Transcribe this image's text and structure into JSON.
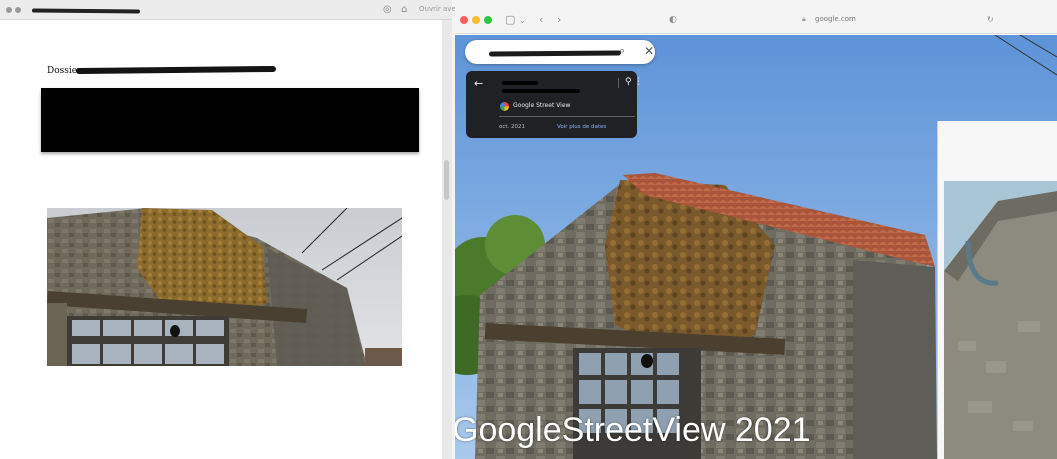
{
  "left_window": {
    "url_fragment": "Ouvrir avec",
    "dossier_label": "Dossier"
  },
  "browser": {
    "url": "google.com",
    "traffic_lights": {
      "close": "#fe5f57",
      "minimize": "#febc2e",
      "maximize": "#28c840"
    }
  },
  "streetview_card": {
    "service_name": "Google Street View",
    "date": "oct. 2021",
    "more_dates_link": "Voir plus de dates"
  },
  "caption": {
    "text": "GoogleStreetView 2021"
  }
}
